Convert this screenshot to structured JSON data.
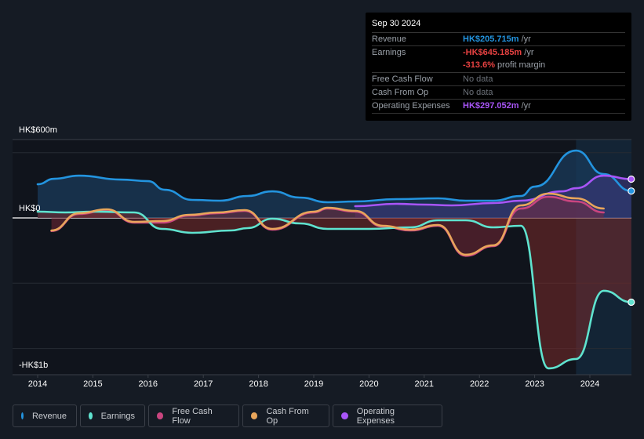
{
  "tooltip": {
    "date": "Sep 30 2024",
    "rows": [
      {
        "label": "Revenue",
        "value": "HK$205.715m",
        "unit": " /yr",
        "color": "#2394df"
      },
      {
        "label": "Earnings",
        "value": "-HK$645.185m",
        "unit": " /yr",
        "color": "#e64141"
      },
      {
        "label": "",
        "value": "-313.6%",
        "unit": " profit margin",
        "color": "#e64141"
      },
      {
        "label": "Free Cash Flow",
        "value": "",
        "unit": "No data",
        "color": "#9aa0a8"
      },
      {
        "label": "Cash From Op",
        "value": "",
        "unit": "No data",
        "color": "#9aa0a8"
      },
      {
        "label": "Operating Expenses",
        "value": "HK$297.052m",
        "unit": " /yr",
        "color": "#a855f7"
      }
    ]
  },
  "legend": [
    {
      "label": "Revenue",
      "color": "#2394df"
    },
    {
      "label": "Earnings",
      "color": "#5fe3cf"
    },
    {
      "label": "Free Cash Flow",
      "color": "#c9457f"
    },
    {
      "label": "Cash From Op",
      "color": "#e8a55b"
    },
    {
      "label": "Operating Expenses",
      "color": "#a855f7"
    }
  ],
  "chart_data": {
    "type": "line",
    "title": "",
    "xlabel": "",
    "ylabel": "",
    "y_tick_labels": [
      {
        "value": 600,
        "label": "HK$600m"
      },
      {
        "value": 0,
        "label": "HK$0"
      },
      {
        "value": -1000,
        "label": "-HK$1b"
      }
    ],
    "ylim": [
      -1200,
      600
    ],
    "xlim": [
      2013.98,
      2024.75
    ],
    "x_ticks": [
      "2014",
      "2015",
      "2016",
      "2017",
      "2018",
      "2019",
      "2020",
      "2021",
      "2022",
      "2023",
      "2024"
    ],
    "gridlines_at": [
      500,
      0,
      -500,
      -1000
    ],
    "highlight_region_start": 2023.75,
    "units": "HK$ millions",
    "series": [
      {
        "name": "Revenue",
        "color": "#2394df",
        "fill": true,
        "end_marker": true,
        "x": [
          2014.0,
          2014.3,
          2014.75,
          2015.5,
          2016.0,
          2016.3,
          2016.8,
          2017.3,
          2017.8,
          2018.25,
          2018.75,
          2019.25,
          2019.75,
          2020.5,
          2021.25,
          2021.75,
          2022.25,
          2022.75,
          2023.0,
          2023.75,
          2024.25,
          2024.75
        ],
        "values": [
          258,
          300,
          324,
          294,
          282,
          216,
          138,
          132,
          168,
          204,
          156,
          120,
          126,
          144,
          150,
          132,
          132,
          168,
          240,
          516,
          336,
          206
        ]
      },
      {
        "name": "Earnings",
        "color": "#5fe3cf",
        "fill": true,
        "end_marker": true,
        "x": [
          2014.0,
          2014.5,
          2015.0,
          2015.75,
          2016.25,
          2016.8,
          2017.5,
          2017.8,
          2018.25,
          2018.75,
          2019.25,
          2020.0,
          2020.75,
          2021.25,
          2021.75,
          2022.25,
          2022.75,
          2023.25,
          2023.75,
          2024.25,
          2024.75
        ],
        "values": [
          48,
          42,
          48,
          42,
          -84,
          -114,
          -96,
          -78,
          -6,
          -42,
          -84,
          -84,
          -72,
          -18,
          -18,
          -72,
          -60,
          -1152,
          -1080,
          -558,
          -645
        ]
      },
      {
        "name": "Free Cash Flow",
        "color": "#c9457f",
        "fill": true,
        "end_marker": false,
        "x": [
          2014.25,
          2014.75,
          2015.25,
          2015.75,
          2016.25,
          2016.75,
          2017.25,
          2017.75,
          2018.25,
          2019.0,
          2019.25,
          2019.75,
          2020.25,
          2020.75,
          2021.25,
          2021.75,
          2022.25,
          2022.75,
          2023.25,
          2023.75,
          2024.25
        ],
        "values": [
          -100,
          30,
          60,
          -36,
          -36,
          18,
          36,
          54,
          -90,
          42,
          72,
          48,
          -66,
          -96,
          -60,
          -290,
          -216,
          72,
          162,
          126,
          42
        ]
      },
      {
        "name": "Cash From Op",
        "color": "#e8a55b",
        "fill": false,
        "end_marker": false,
        "x": [
          2014.25,
          2014.75,
          2015.25,
          2015.75,
          2016.25,
          2016.75,
          2017.25,
          2017.75,
          2018.25,
          2019.0,
          2019.25,
          2019.75,
          2020.25,
          2020.75,
          2021.25,
          2021.75,
          2022.25,
          2022.75,
          2023.25,
          2023.75,
          2024.25
        ],
        "values": [
          -96,
          36,
          66,
          -30,
          -24,
          24,
          42,
          60,
          -84,
          48,
          78,
          54,
          -60,
          -90,
          -54,
          -282,
          -210,
          96,
          186,
          150,
          72
        ]
      },
      {
        "name": "Operating Expenses",
        "color": "#a855f7",
        "fill": true,
        "end_marker": true,
        "x": [
          2019.75,
          2020.5,
          2021.0,
          2021.5,
          2022.25,
          2022.75,
          2023.5,
          2023.75,
          2024.25,
          2024.75
        ],
        "values": [
          90,
          108,
          102,
          96,
          114,
          132,
          204,
          228,
          324,
          297
        ]
      }
    ]
  }
}
